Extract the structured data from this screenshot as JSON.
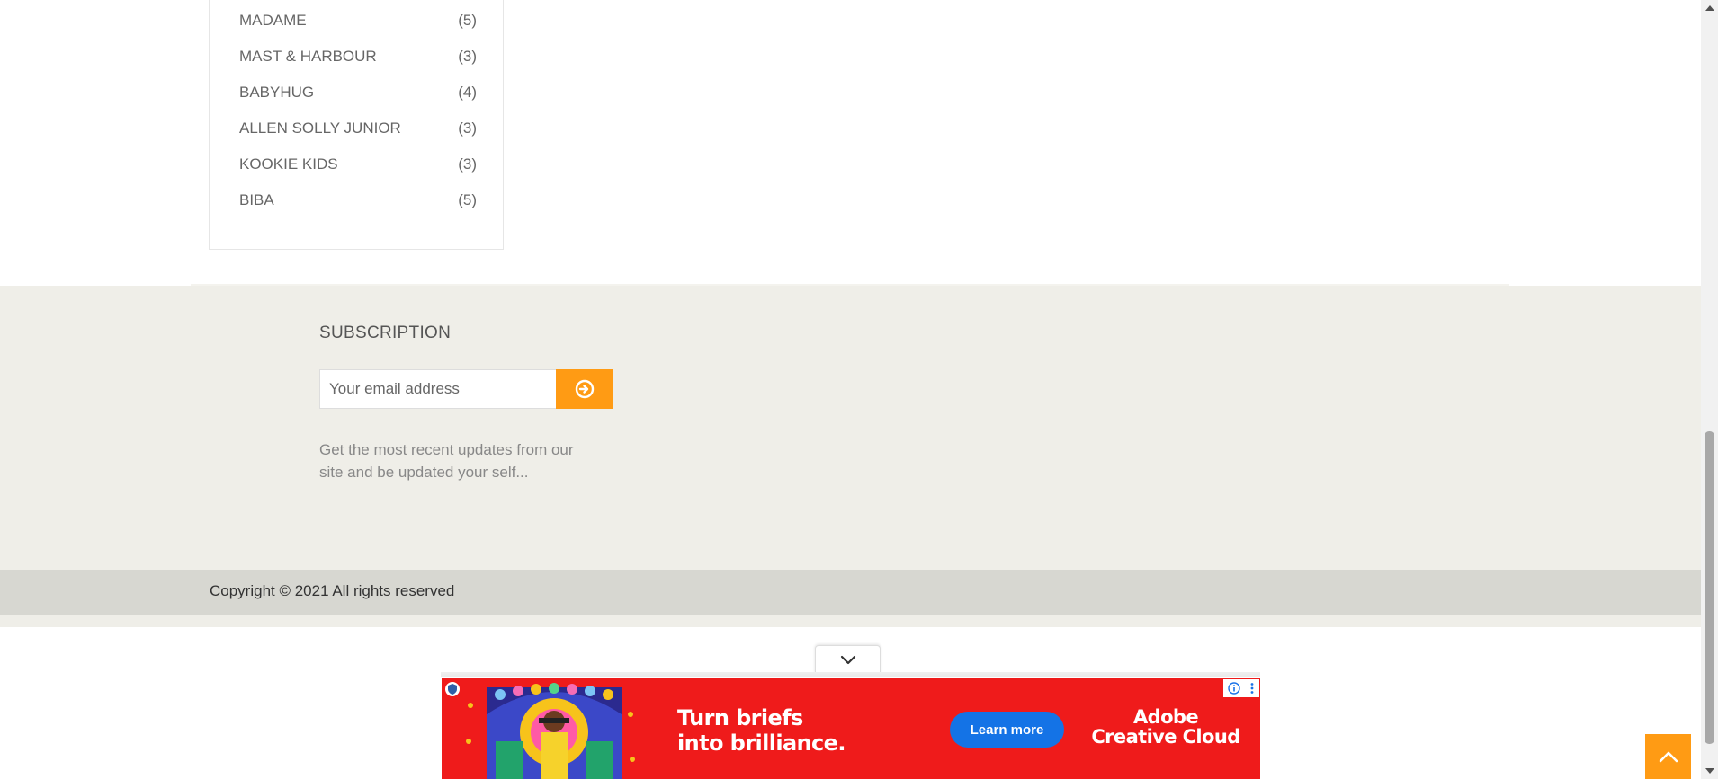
{
  "brands": [
    {
      "name": "MADAME",
      "count": "(5)"
    },
    {
      "name": "MAST & HARBOUR",
      "count": "(3)"
    },
    {
      "name": "BABYHUG",
      "count": "(4)"
    },
    {
      "name": "ALLEN SOLLY JUNIOR",
      "count": "(3)"
    },
    {
      "name": "KOOKIE KIDS",
      "count": "(3)"
    },
    {
      "name": "BIBA",
      "count": "(5)"
    }
  ],
  "subscription": {
    "title": "SUBSCRIPTION",
    "email_placeholder": "Your email address",
    "description": "Get the most recent updates from our site and be updated your self...",
    "button_color": "#ff9b14"
  },
  "footer": {
    "copyright": "Copyright © 2021 All rights reserved"
  },
  "ad": {
    "headline_line1": "Turn briefs",
    "headline_line2": "into brilliance.",
    "cta": "Learn more",
    "brand_line1": "Adobe",
    "brand_line2": "Creative Cloud",
    "background_color": "#ef1b1b",
    "cta_color": "#1473e6"
  },
  "icons": {
    "subscribe": "arrow-circle-right-icon",
    "collapse_ad": "chevron-down-icon",
    "back_to_top": "chevron-up-icon",
    "ad_info": "info-icon",
    "ad_menu": "kebab-menu-icon"
  }
}
